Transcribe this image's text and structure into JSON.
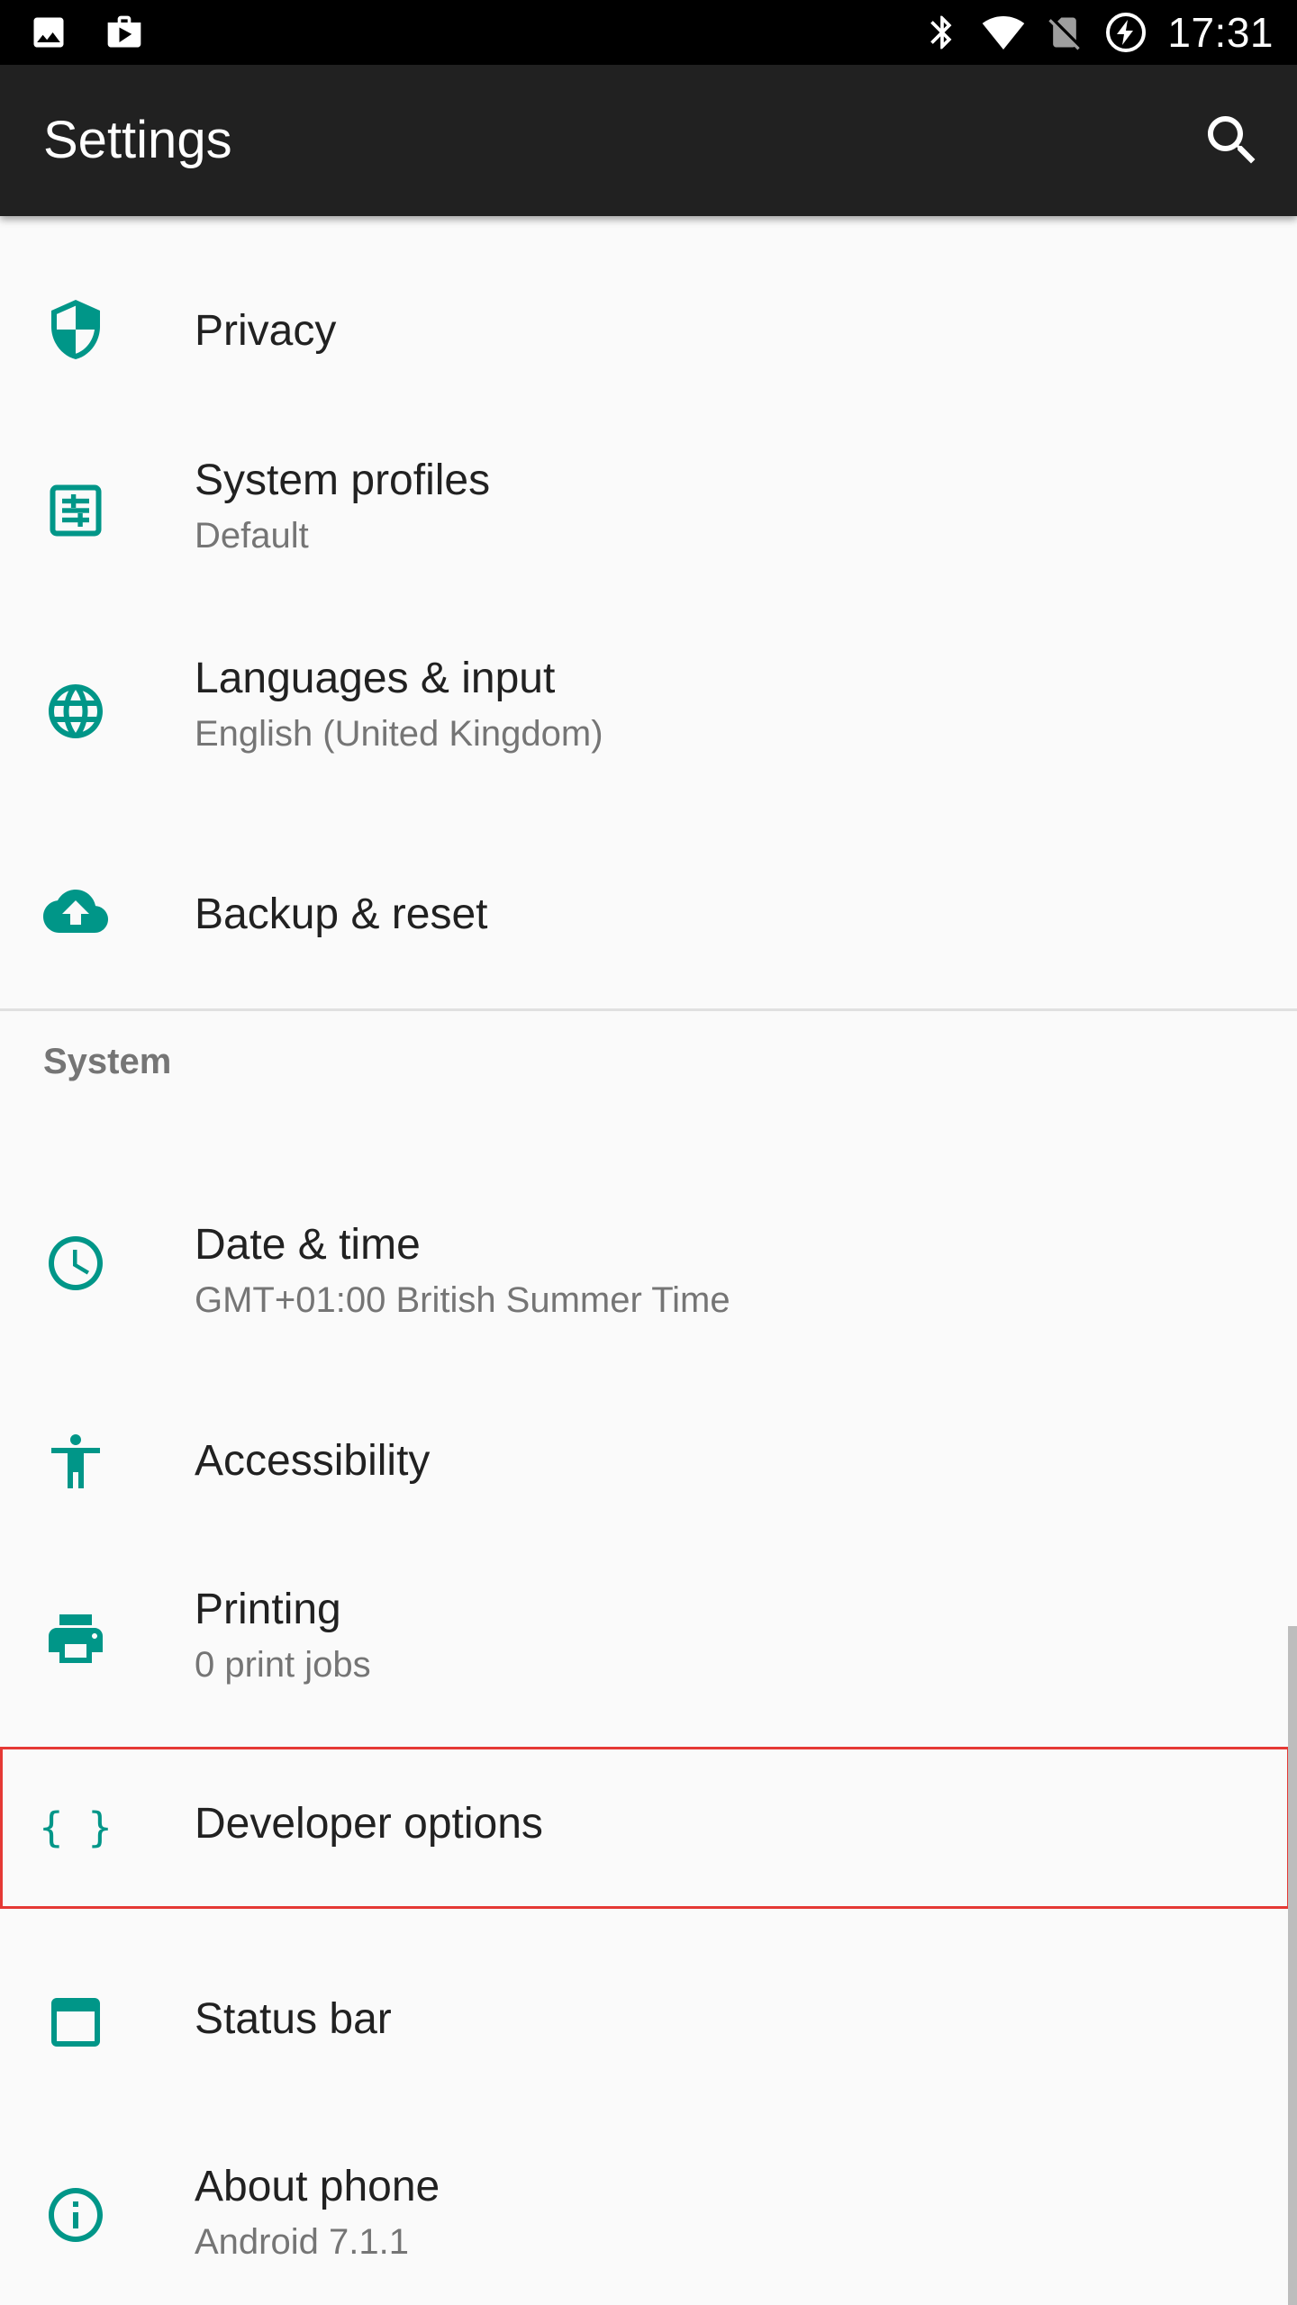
{
  "status_bar": {
    "time": "17:31",
    "left_icons": [
      "image-notification-icon",
      "play-store-notification-icon"
    ],
    "right_icons": [
      "bluetooth-icon",
      "wifi-icon",
      "no-sim-icon",
      "battery-charging-icon"
    ]
  },
  "app_bar": {
    "title": "Settings",
    "search_icon": "search-icon"
  },
  "colors": {
    "accent": "#009688",
    "app_bar": "#212121",
    "status_bar": "#000000",
    "background": "#fafafa",
    "title_text": "#212121",
    "summary_text": "#757575",
    "highlight": "#e53935"
  },
  "items_personal": [
    {
      "id": "privacy",
      "icon": "shield-icon",
      "title": "Privacy",
      "summary": ""
    },
    {
      "id": "system-profiles",
      "icon": "profiles-icon",
      "title": "System profiles",
      "summary": "Default"
    },
    {
      "id": "languages",
      "icon": "globe-icon",
      "title": "Languages & input",
      "summary": "English (United Kingdom)"
    },
    {
      "id": "backup",
      "icon": "cloud-upload-icon",
      "title": "Backup & reset",
      "summary": ""
    }
  ],
  "system_section": {
    "header": "System",
    "items": [
      {
        "id": "date-time",
        "icon": "clock-icon",
        "title": "Date & time",
        "summary": "GMT+01:00 British Summer Time"
      },
      {
        "id": "accessibility",
        "icon": "accessibility-icon",
        "title": "Accessibility",
        "summary": ""
      },
      {
        "id": "printing",
        "icon": "printer-icon",
        "title": "Printing",
        "summary": "0 print jobs"
      },
      {
        "id": "developer",
        "icon": "braces-icon",
        "title": "Developer options",
        "summary": ""
      },
      {
        "id": "status-bar",
        "icon": "status-bar-icon",
        "title": "Status bar",
        "summary": ""
      },
      {
        "id": "about",
        "icon": "info-icon",
        "title": "About phone",
        "summary": "Android 7.1.1"
      }
    ]
  }
}
